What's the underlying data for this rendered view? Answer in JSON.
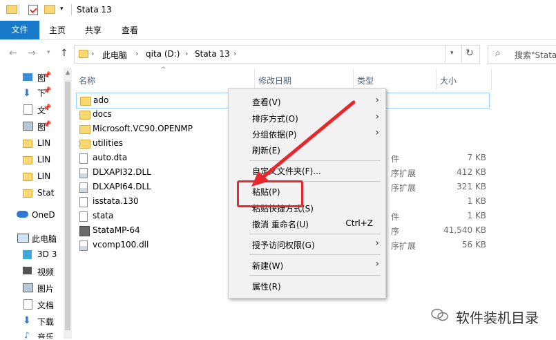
{
  "window": {
    "title": "Stata 13"
  },
  "ribbon": {
    "tabs": [
      "文件",
      "主页",
      "共享",
      "查看"
    ]
  },
  "address": {
    "crumbs": [
      "此电脑",
      "qita (D:)",
      "Stata 13"
    ],
    "search_placeholder": "搜索\"Stata"
  },
  "sidebar": {
    "items": [
      "图",
      "下",
      "文",
      "图",
      "LIN",
      "LIN",
      "LIN",
      "Stat",
      "OneD",
      "此电脑",
      "3D 3",
      "视频",
      "图片",
      "文档",
      "下载",
      "音乐"
    ]
  },
  "columns": {
    "name": "名称",
    "date": "修改日期",
    "type": "类型",
    "size": "大小"
  },
  "files": [
    {
      "name": "ado",
      "icon": "folder-icon",
      "type": "",
      "size": ""
    },
    {
      "name": "docs",
      "icon": "folder-icon",
      "type": "",
      "size": ""
    },
    {
      "name": "Microsoft.VC90.OPENMP",
      "icon": "folder-icon",
      "type": "",
      "size": ""
    },
    {
      "name": "utilities",
      "icon": "folder-icon",
      "type": "",
      "size": ""
    },
    {
      "name": "auto.dta",
      "icon": "file-icon",
      "type": "件",
      "size": "7 KB"
    },
    {
      "name": "DLXAPI32.DLL",
      "icon": "dll-icon",
      "type": "序扩展",
      "size": "412 KB"
    },
    {
      "name": "DLXAPI64.DLL",
      "icon": "dll-icon",
      "type": "序扩展",
      "size": "321 KB"
    },
    {
      "name": "isstata.130",
      "icon": "file-icon",
      "type": "",
      "size": "1 KB"
    },
    {
      "name": "stata",
      "icon": "file-icon",
      "type": "件",
      "size": "1 KB"
    },
    {
      "name": "StataMP-64",
      "icon": "app-icon",
      "type": "序",
      "size": "41,540 KB"
    },
    {
      "name": "vcomp100.dll",
      "icon": "dll-icon",
      "type": "序扩展",
      "size": "56 KB"
    }
  ],
  "context_menu": {
    "view": "查看(V)",
    "sort": "排序方式(O)",
    "group": "分组依据(P)",
    "refresh": "刷新(E)",
    "customize": "自定义文件夹(F)...",
    "paste": "粘贴(P)",
    "paste_shortcut": "粘贴快捷方式(S)",
    "undo": "撤消 重命名(U)",
    "undo_shortcut": "Ctrl+Z",
    "grant": "授予访问权限(G)",
    "new": "新建(W)",
    "properties": "属性(R)"
  },
  "watermark": "软件装机目录",
  "colors": {
    "accent": "#1979ca",
    "highlight": "#e8262d"
  }
}
